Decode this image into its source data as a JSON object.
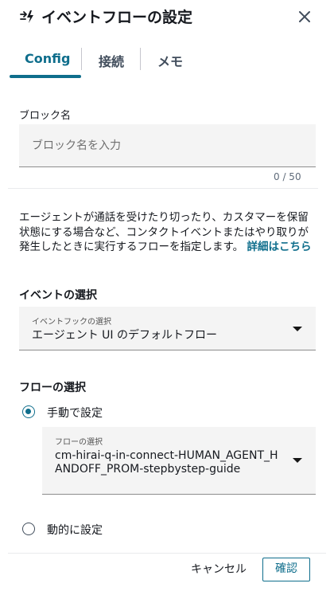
{
  "header": {
    "title": "イベントフローの設定"
  },
  "tabs": [
    {
      "label": "Config"
    },
    {
      "label": "接続"
    },
    {
      "label": "メモ"
    }
  ],
  "block_name": {
    "label": "ブロック名",
    "placeholder": "ブロック名を入力",
    "value": "",
    "counter": "0 / 50"
  },
  "description": {
    "text": "エージェントが通話を受けたり切ったり、カスタマーを保留状態にする場合など、コンタクトイベントまたはやり取りが発生したときに実行するフローを指定します。",
    "link": "詳細はこちら"
  },
  "event_selection": {
    "heading": "イベントの選択",
    "select_label": "イベントフックの選択",
    "select_value": "エージェント UI のデフォルトフロー"
  },
  "flow_selection": {
    "heading": "フローの選択",
    "manual_label": "手動で設定",
    "manual_checked": true,
    "select_label": "フローの選択",
    "select_value": "cm-hirai-q-in-connect-HUMAN_AGENT_HANDOFF_PROM-stepbystep-guide",
    "dynamic_label": "動的に設定",
    "dynamic_checked": false
  },
  "footer": {
    "cancel_label": "キャンセル",
    "confirm_label": "確認"
  },
  "colors": {
    "accent": "#0f6e8c",
    "text": "#16191f",
    "field_bg": "#f4f4f4"
  }
}
